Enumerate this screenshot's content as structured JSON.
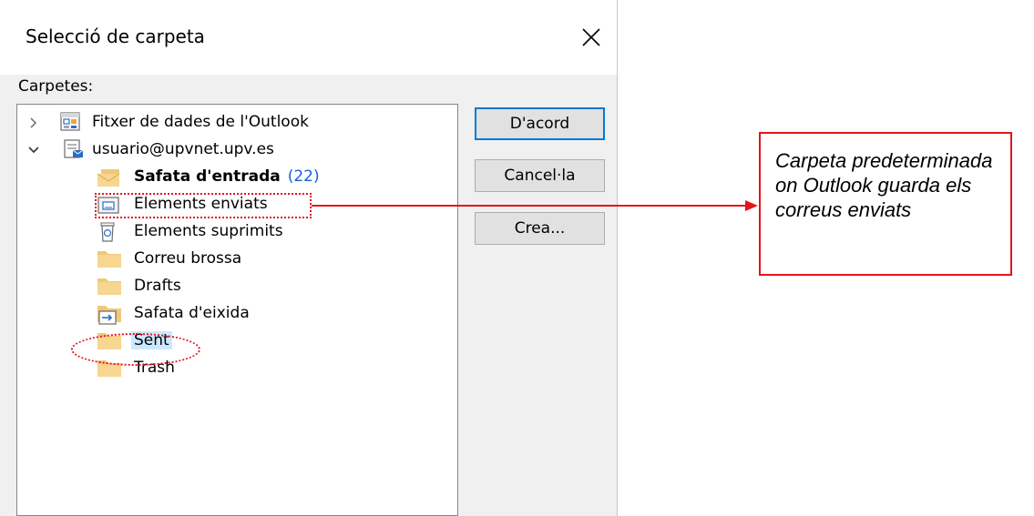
{
  "dialog": {
    "title": "Selecció de carpeta",
    "folders_label": "Carpetes:",
    "tree": {
      "root_items": [
        {
          "label": "Fitxer de dades de l'Outlook",
          "expanded": false,
          "icon": "data-file-icon"
        },
        {
          "label": "usuario@upvnet.upv.es",
          "expanded": true,
          "icon": "account-icon"
        }
      ],
      "folders": [
        {
          "label": "Safata d'entrada",
          "count": "(22)",
          "icon": "inbox-icon"
        },
        {
          "label": "Elements enviats",
          "icon": "sent-items-icon"
        },
        {
          "label": "Elements suprimits",
          "icon": "trash-bin-icon"
        },
        {
          "label": "Correu brossa",
          "icon": "folder-icon"
        },
        {
          "label": "Drafts",
          "icon": "folder-icon"
        },
        {
          "label": "Safata d'eixida",
          "icon": "outbox-icon"
        },
        {
          "label": "Sent",
          "icon": "folder-icon",
          "selected": true
        },
        {
          "label": "Trash",
          "icon": "folder-icon"
        }
      ]
    },
    "buttons": {
      "ok": "D'acord",
      "cancel": "Cancel·la",
      "create": "Crea..."
    }
  },
  "annotation": {
    "callout_text": "Carpeta predeterminada on Outlook guarda els correus enviats",
    "color": "#e4141b"
  },
  "colors": {
    "dialog_bg": "#f0f0f0",
    "selection": "#cce8ff",
    "accent": "#0078d7",
    "count": "#1a5fd8",
    "folder": "#f0c879"
  }
}
